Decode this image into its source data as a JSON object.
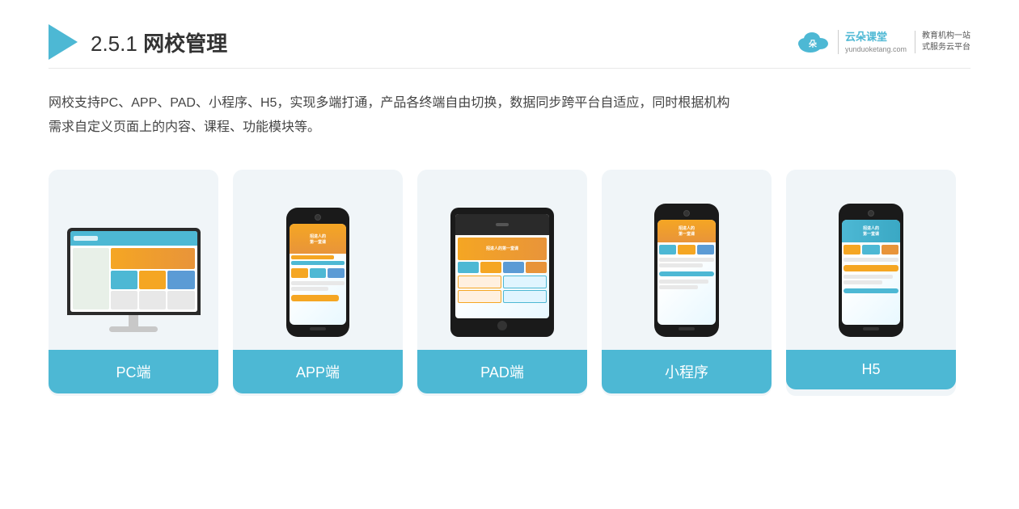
{
  "header": {
    "title_prefix": "2.5.1 ",
    "title_bold": "网校管理",
    "brand_name": "云朵课堂",
    "brand_url": "yunduoketang.com",
    "brand_tagline_line1": "教育机构一站",
    "brand_tagline_line2": "式服务云平台"
  },
  "description": {
    "text_line1": "网校支持PC、APP、PAD、小程序、H5，实现多端打通，产品各终端自由切换，数据同步跨平台自适应，同时根据机构",
    "text_line2": "需求自定义页面上的内容、课程、功能模块等。"
  },
  "cards": [
    {
      "id": "pc",
      "label": "PC端"
    },
    {
      "id": "app",
      "label": "APP端"
    },
    {
      "id": "pad",
      "label": "PAD端"
    },
    {
      "id": "mini",
      "label": "小程序"
    },
    {
      "id": "h5",
      "label": "H5"
    }
  ],
  "colors": {
    "teal": "#4db8d4",
    "orange": "#f5a623",
    "dark": "#1a1a1a",
    "bg_card": "#eef4f8"
  }
}
